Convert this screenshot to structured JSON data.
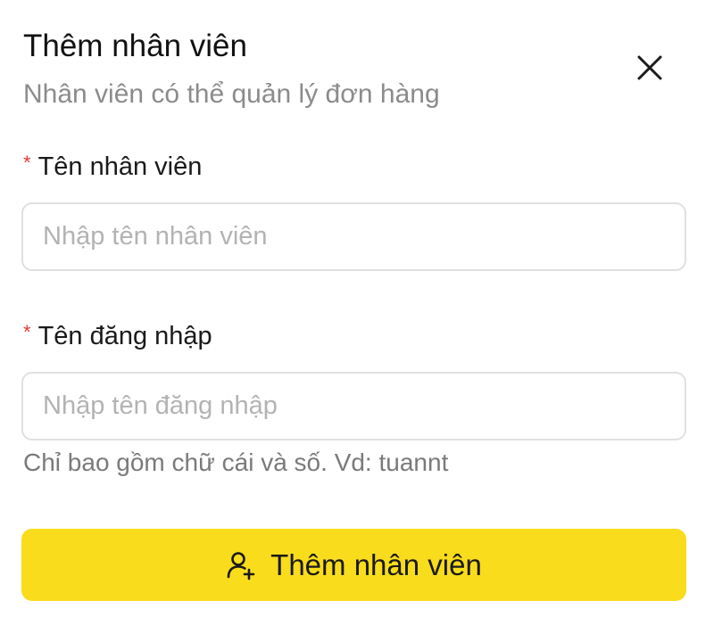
{
  "dialog": {
    "title": "Thêm nhân viên",
    "subtitle": "Nhân viên có thể quản lý đơn hàng",
    "close_icon": "close-icon"
  },
  "form": {
    "required_mark": "*",
    "name_field": {
      "label": "Tên nhân viên",
      "placeholder": "Nhập tên nhân viên",
      "value": ""
    },
    "username_field": {
      "label": "Tên đăng nhập",
      "placeholder": "Nhập tên đăng nhập",
      "value": "",
      "hint": "Chỉ bao gồm chữ cái và số. Vd: tuannt"
    }
  },
  "submit": {
    "label": "Thêm nhân viên",
    "icon": "add-user-icon"
  },
  "colors": {
    "accent": "#f9dc1c",
    "required": "#e53935",
    "muted_text": "#8b8b8b",
    "border": "#e0e0e0"
  }
}
